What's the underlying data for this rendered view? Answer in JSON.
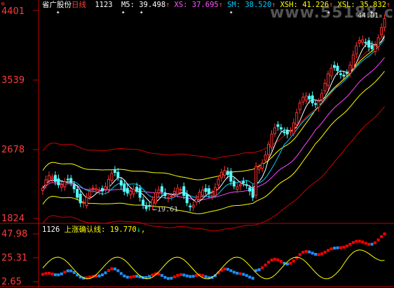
{
  "window": {
    "title": "省广股份 日线"
  },
  "main_header": {
    "name": "省广股份",
    "period": "日线",
    "code": "1123",
    "indicators": [
      {
        "label": "M5:",
        "value": "39.498",
        "arrow": "↑",
        "color": "#ffffff"
      },
      {
        "label": "XS:",
        "value": "37.695",
        "arrow": "↑",
        "color": "#ff55ff"
      },
      {
        "label": "SM:",
        "value": "38.520",
        "arrow": "↑",
        "color": "#00ccff"
      },
      {
        "label": "XSH:",
        "value": "41.226",
        "arrow": "↑",
        "color": "#ffff00"
      },
      {
        "label": "XSL:",
        "value": "35.832",
        "arrow": "↑",
        "color": "#ffff00"
      }
    ]
  },
  "price_axis": {
    "labels": [
      "4401",
      "3539",
      "2678",
      "1824"
    ]
  },
  "annotations": {
    "low_label": "19.61",
    "high_label": "44.01"
  },
  "watermark": "www.55188.cn",
  "sub_header": {
    "code": "1126",
    "title": "上涨确认线:",
    "value": "19.770",
    "arrow": "↓",
    "suffix": ","
  },
  "sub_axis": {
    "labels": [
      "47.98",
      "25.31",
      "2.65"
    ]
  },
  "colors": {
    "up": "#ff3030",
    "down": "#55ffff",
    "bull_red": "#ff0000",
    "bear_blue": "#1e90ff",
    "ma_white": "#ffffff",
    "ma_magenta": "#ff44ff",
    "ma_cyan": "#00ccff",
    "band_yellow": "#ffff00",
    "band_red": "#cc0000",
    "axis": "#c00000",
    "corner_icon": "#ff2a2a"
  },
  "icons": {
    "corner": "gear-icon"
  }
}
